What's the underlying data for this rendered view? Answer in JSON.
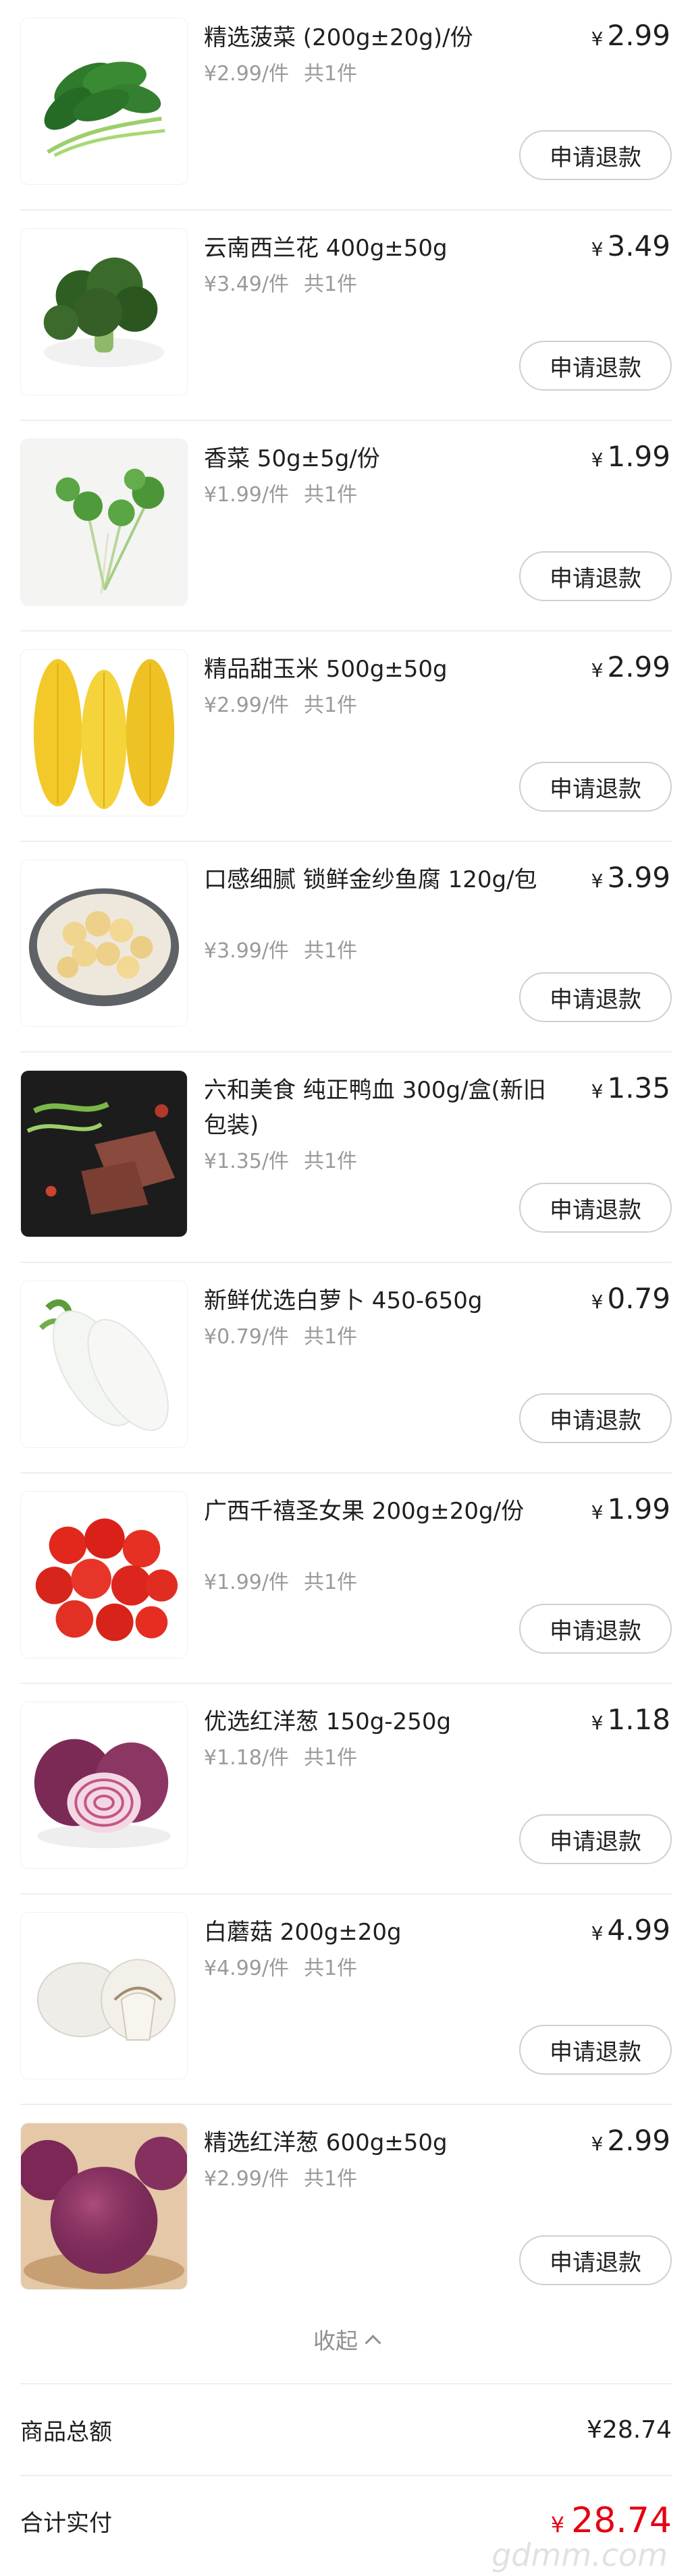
{
  "items": [
    {
      "name": "精选菠菜 (200g±20g)/份",
      "unit_price": "¥2.99/件",
      "qty": "共1件",
      "currency": "¥",
      "price": "2.99",
      "refund": "申请退款",
      "image": "spinach"
    },
    {
      "name": "云南西兰花 400g±50g",
      "unit_price": "¥3.49/件",
      "qty": "共1件",
      "currency": "¥",
      "price": "3.49",
      "refund": "申请退款",
      "image": "broccoli"
    },
    {
      "name": "香菜 50g±5g/份",
      "unit_price": "¥1.99/件",
      "qty": "共1件",
      "currency": "¥",
      "price": "1.99",
      "refund": "申请退款",
      "image": "coriander"
    },
    {
      "name": "精品甜玉米 500g±50g",
      "unit_price": "¥2.99/件",
      "qty": "共1件",
      "currency": "¥",
      "price": "2.99",
      "refund": "申请退款",
      "image": "corn"
    },
    {
      "name": "口感细腻 锁鲜金纱鱼腐 120g/包",
      "unit_price": "¥3.99/件",
      "qty": "共1件",
      "currency": "¥",
      "price": "3.99",
      "refund": "申请退款",
      "image": "fish-tofu"
    },
    {
      "name": "六和美食 纯正鸭血 300g/盒(新旧包装)",
      "unit_price": "¥1.35/件",
      "qty": "共1件",
      "currency": "¥",
      "price": "1.35",
      "refund": "申请退款",
      "image": "duck-blood"
    },
    {
      "name": "新鲜优选白萝卜 450-650g",
      "unit_price": "¥0.79/件",
      "qty": "共1件",
      "currency": "¥",
      "price": "0.79",
      "refund": "申请退款",
      "image": "radish"
    },
    {
      "name": "广西千禧圣女果 200g±20g/份",
      "unit_price": "¥1.99/件",
      "qty": "共1件",
      "currency": "¥",
      "price": "1.99",
      "refund": "申请退款",
      "image": "tomato"
    },
    {
      "name": "优选红洋葱 150g-250g",
      "unit_price": "¥1.18/件",
      "qty": "共1件",
      "currency": "¥",
      "price": "1.18",
      "refund": "申请退款",
      "image": "onion"
    },
    {
      "name": "白蘑菇 200g±20g",
      "unit_price": "¥4.99/件",
      "qty": "共1件",
      "currency": "¥",
      "price": "4.99",
      "refund": "申请退款",
      "image": "mushroom"
    },
    {
      "name": "精选红洋葱 600g±50g",
      "unit_price": "¥2.99/件",
      "qty": "共1件",
      "currency": "¥",
      "price": "2.99",
      "refund": "申请退款",
      "image": "onion-large"
    }
  ],
  "collapse_label": "收起",
  "summary": {
    "goods_total_label": "商品总额",
    "goods_total_value": "¥28.74",
    "paid_label": "合计实付",
    "paid_currency": "¥",
    "paid_value": "28.74"
  },
  "watermark": "gdmm.com",
  "colors": {
    "accent_red": "#e60012",
    "muted_text": "#9a9a9a",
    "divider": "#eeeeee"
  }
}
